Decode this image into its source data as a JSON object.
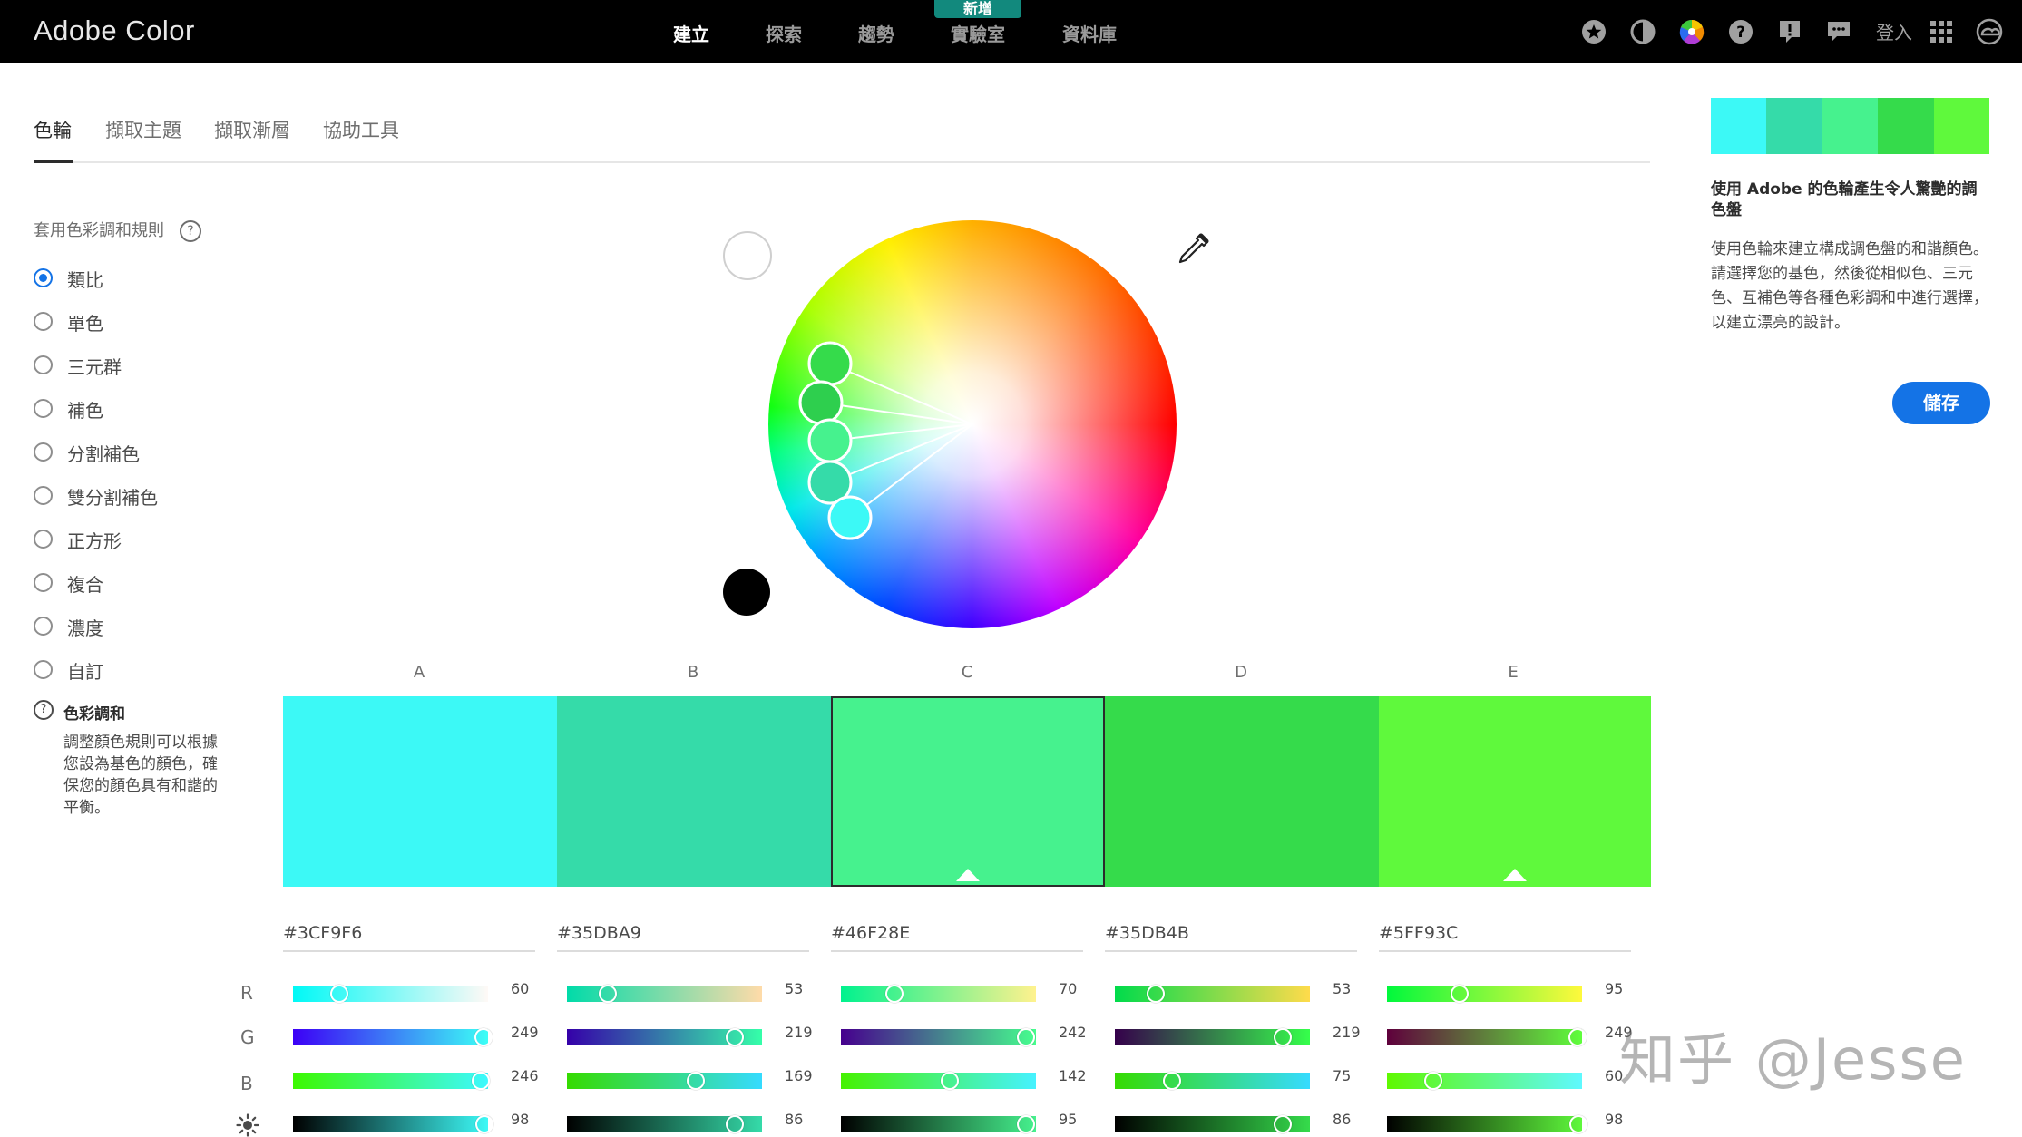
{
  "app": {
    "title": "Adobe Color"
  },
  "nav": {
    "items": [
      {
        "label": "建立",
        "active": true
      },
      {
        "label": "探索",
        "active": false
      },
      {
        "label": "趨勢",
        "active": false
      },
      {
        "label": "實驗室",
        "active": false
      },
      {
        "label": "資料庫",
        "active": false
      }
    ],
    "new_badge": "新增",
    "signin": "登入",
    "icons": [
      "star-icon",
      "contrast-icon",
      "color-wheel-icon",
      "help-icon",
      "alert-icon",
      "chat-icon",
      "apps-grid-icon",
      "creative-cloud-icon"
    ]
  },
  "tabs": [
    {
      "label": "色輪",
      "active": true
    },
    {
      "label": "擷取主題",
      "active": false
    },
    {
      "label": "擷取漸層",
      "active": false
    },
    {
      "label": "協助工具",
      "active": false
    }
  ],
  "rules": {
    "heading": "套用色彩調和規則",
    "help": "?",
    "options": [
      {
        "label": "類比",
        "checked": true
      },
      {
        "label": "單色",
        "checked": false
      },
      {
        "label": "三元群",
        "checked": false
      },
      {
        "label": "補色",
        "checked": false
      },
      {
        "label": "分割補色",
        "checked": false
      },
      {
        "label": "雙分割補色",
        "checked": false
      },
      {
        "label": "正方形",
        "checked": false
      },
      {
        "label": "複合",
        "checked": false
      },
      {
        "label": "濃度",
        "checked": false
      },
      {
        "label": "自訂",
        "checked": false
      }
    ]
  },
  "harmony": {
    "icon": "?",
    "title": "色彩調和",
    "text": "調整顏色規則可以根據您設為基色的顏色，確保您的顏色具有和諧的平衡。"
  },
  "palette": {
    "selected_index": 2,
    "colors": [
      {
        "letter": "A",
        "hex": "#3CF9F6",
        "r": 60,
        "g": 249,
        "b": 246,
        "brightness": 98
      },
      {
        "letter": "B",
        "hex": "#35DBA9",
        "r": 53,
        "g": 219,
        "b": 169,
        "brightness": 86
      },
      {
        "letter": "C",
        "hex": "#46F28E",
        "r": 70,
        "g": 242,
        "b": 142,
        "brightness": 95
      },
      {
        "letter": "D",
        "hex": "#35DB4B",
        "r": 53,
        "g": 219,
        "b": 75,
        "brightness": 86
      },
      {
        "letter": "E",
        "hex": "#5FF93C",
        "r": 95,
        "g": 249,
        "b": 60,
        "brightness": 98
      }
    ]
  },
  "channels": {
    "r": "R",
    "g": "G",
    "b": "B"
  },
  "right_panel": {
    "title": "使用 Adobe 的色輪產生令人驚艷的調色盤",
    "text": "使用色輪來建立構成調色盤的和諧顏色。請選擇您的基色，然後從相似色、三元色、互補色等各種色彩調和中進行選擇，以建立漂亮的設計。",
    "save_label": "儲存"
  },
  "watermark": "知乎 @Jesse"
}
